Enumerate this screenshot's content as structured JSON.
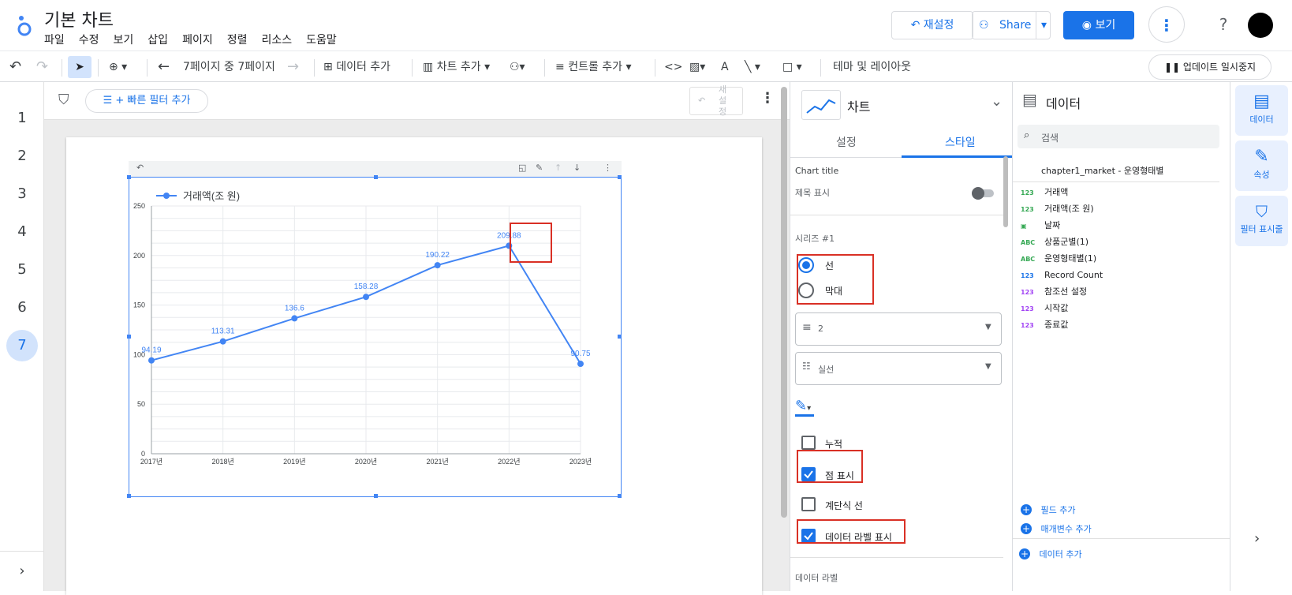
{
  "app": {
    "title": "기본 차트",
    "menu": [
      "파일",
      "수정",
      "보기",
      "삽입",
      "페이지",
      "정렬",
      "리소스",
      "도움말"
    ],
    "reset_label": "재설정",
    "share_label": "Share",
    "view_label": "보기"
  },
  "toolbar": {
    "page_nav": "7페이지 중 7페이지",
    "add_data": "데이터 추가",
    "add_chart": "차트 추가",
    "add_control": "컨트롤 추가",
    "theme_layout": "테마 및 레이아웃",
    "pause_updates": "업데이트 일시중지"
  },
  "pages": [
    "1",
    "2",
    "3",
    "4",
    "5",
    "6",
    "7"
  ],
  "active_page": "7",
  "filterbar": {
    "quick_filter": "+ 빠른 필터 추가",
    "reset_vertical": [
      "새",
      "설",
      "정"
    ]
  },
  "chart_data": {
    "type": "line",
    "categories": [
      "2017년",
      "2018년",
      "2019년",
      "2020년",
      "2021년",
      "2022년",
      "2023년"
    ],
    "series": [
      {
        "name": "거래액(조 원)",
        "values": [
          94.19,
          113.31,
          136.6,
          158.28,
          190.22,
          209.88,
          90.75
        ],
        "labels": [
          "94.19",
          "113.31",
          "136.6",
          "158.28",
          "190.22",
          "209.88",
          "90.75"
        ]
      }
    ],
    "yticks": [
      "0",
      "50",
      "100",
      "150",
      "200",
      "250"
    ],
    "ylim": [
      0,
      250
    ],
    "grid": true,
    "legend": "top-left",
    "color": "#4285f4"
  },
  "style_panel": {
    "chart_type_label": "차트",
    "tabs": [
      "설정",
      "스타일"
    ],
    "active_tab": "스타일",
    "chart_title_section": "Chart title",
    "show_title": "제목 표시",
    "series_label": "시리즈 #1",
    "radio_line": "선",
    "radio_bar": "막대",
    "weight_value": "2",
    "linetype_value": "실선",
    "checkboxes": [
      {
        "label": "누적",
        "checked": false
      },
      {
        "label": "점 표시",
        "checked": true
      },
      {
        "label": "계단식 선",
        "checked": false
      },
      {
        "label": "데이터 라벨 표시",
        "checked": true
      }
    ],
    "data_label_section": "데이터 라벨"
  },
  "data_panel": {
    "title": "데이터",
    "search_placeholder": "검색",
    "source": "chapter1_market - 운영형태별",
    "fields": [
      {
        "type": "123",
        "name": "거래액",
        "color": "#34a853"
      },
      {
        "type": "123",
        "name": "거래액(조 원)",
        "color": "#34a853"
      },
      {
        "type": "cal",
        "name": "날짜",
        "color": "#34a853"
      },
      {
        "type": "ABC",
        "name": "상품군별(1)",
        "color": "#34a853"
      },
      {
        "type": "ABC",
        "name": "운영형태별(1)",
        "color": "#34a853"
      },
      {
        "type": "123",
        "name": "Record Count",
        "color": "#1a73e8"
      },
      {
        "type": "123",
        "name": "참조선 설정",
        "color": "#a142f4"
      },
      {
        "type": "123",
        "name": "시작값",
        "color": "#a142f4"
      },
      {
        "type": "123",
        "name": "종료값",
        "color": "#a142f4"
      }
    ],
    "add_field": "필드 추가",
    "add_param": "매개변수 추가",
    "add_data": "데이터 추가"
  },
  "rail": {
    "data": "데이터",
    "properties": "속성",
    "filters": "필터 표시줄"
  },
  "colors": {
    "accent": "#1a73e8",
    "highlight": "#d93025"
  }
}
